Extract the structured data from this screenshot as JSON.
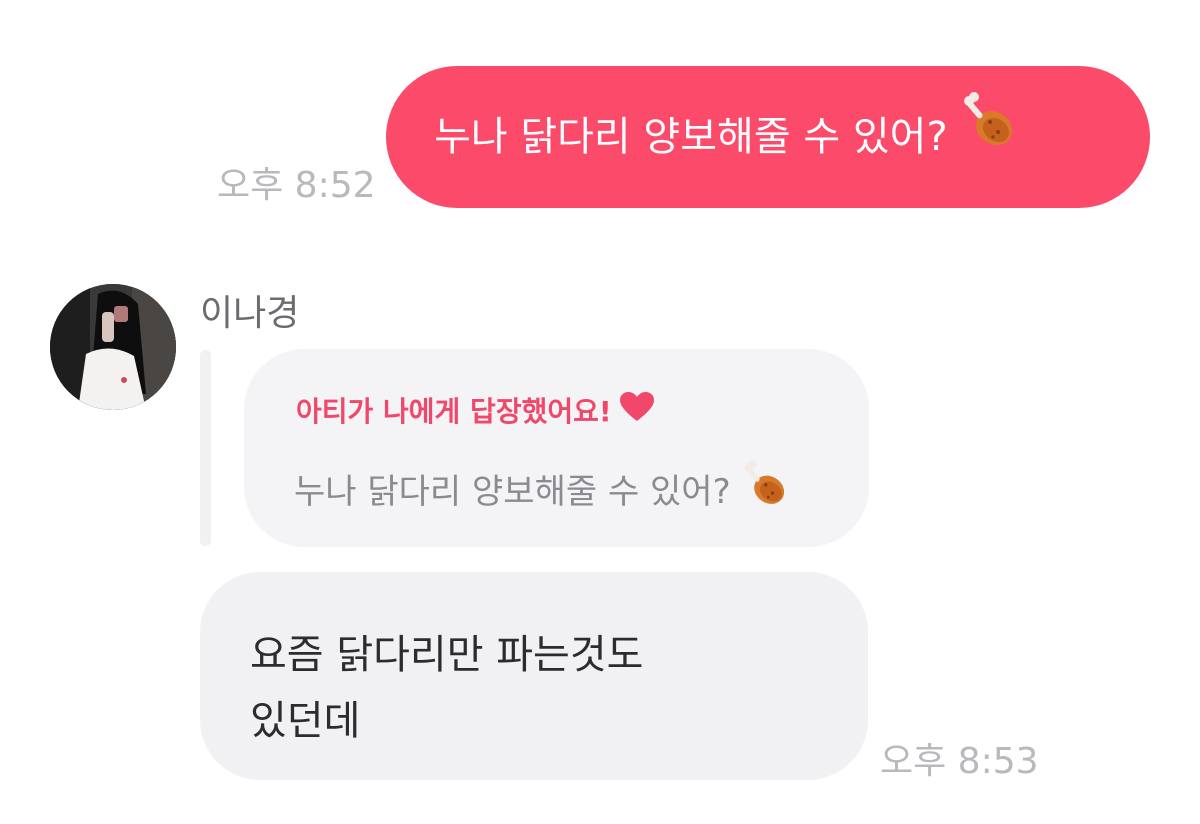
{
  "outgoing": {
    "text": "누나 닭다리 양보해줄 수 있어?",
    "emoji": "poultry-leg-emoji",
    "time": "오후 8:52"
  },
  "incoming": {
    "sender_name": "이나경",
    "avatar": "profile-photo",
    "reply_quote": {
      "title": "아티가 나에게 답장했어요!",
      "title_icon": "heart-icon",
      "quoted_text": "누나 닭다리 양보해줄 수 있어?",
      "quoted_emoji": "poultry-leg-emoji"
    },
    "message_lines": [
      "요즘 닭다리만 파는것도",
      "있던데"
    ],
    "time": "오후 8:53"
  },
  "colors": {
    "outgoing_bubble": "#fc4a6a",
    "reply_title": "#f0476a",
    "heart": "#f0476a",
    "incoming_bubble": "#f1f1f4",
    "timestamp": "#b8b8bd"
  }
}
